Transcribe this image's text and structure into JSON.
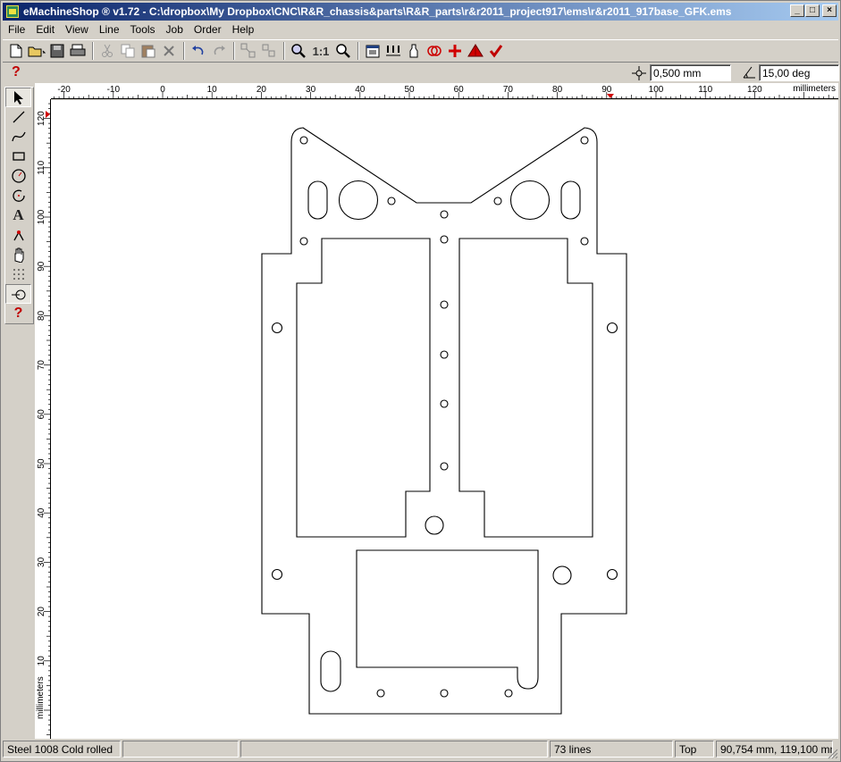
{
  "window": {
    "title": "eMachineShop ® v1.72 - C:\\dropbox\\My Dropbox\\CNC\\R&R_chassis&parts\\R&R_parts\\r&r2011_project917\\ems\\r&r2011_917base_GFK.ems",
    "controls": {
      "minimize": "_",
      "maximize": "□",
      "close": "×"
    }
  },
  "menu": [
    "File",
    "Edit",
    "View",
    "Line",
    "Tools",
    "Job",
    "Order",
    "Help"
  ],
  "toolbar": {
    "icons": [
      "new-icon",
      "open-icon",
      "save-icon",
      "print-icon",
      "cut-icon",
      "copy-icon",
      "paste-icon",
      "delete-icon",
      "undo-icon",
      "redo-icon",
      "group-icon",
      "ungroup-icon",
      "zoom-in-icon",
      "zoom-1to1-icon",
      "zoom-icon",
      "properties-icon",
      "dimension-icon",
      "bottle-icon",
      "check-overlap-icon",
      "add-point-icon",
      "3d-view-icon",
      "check-icon"
    ],
    "zoom_1to1_label": "1:1"
  },
  "snap": {
    "grid_value": "0,500 mm",
    "angle_value": "15,00 deg"
  },
  "palette": [
    "pointer-tool-icon",
    "line-tool-icon",
    "curve-tool-icon",
    "rectangle-tool-icon",
    "circle-tool-icon",
    "arc-tool-icon",
    "text-tool-icon",
    "node-tool-icon",
    "hand-tool-icon",
    "grid-tool-icon",
    "snap-tool-icon",
    "help-tool-icon"
  ],
  "ruler": {
    "unit": "millimeters",
    "h_ticks": [
      "-20",
      "-10",
      "0",
      "10",
      "20",
      "30",
      "40",
      "50",
      "60",
      "70",
      "80",
      "90",
      "100",
      "110",
      "120"
    ],
    "v_ticks": [
      "120",
      "110",
      "100",
      "90",
      "80",
      "70",
      "60",
      "50",
      "40",
      "30",
      "20",
      "10"
    ]
  },
  "status": {
    "material": "Steel 1008 Cold rolled",
    "blank1": "",
    "blank2": "",
    "lines": "73 lines",
    "view": "Top",
    "coords": "90,754 mm, 119,100 mm"
  },
  "colors": {
    "accent": "#0a246a",
    "accent_light": "#a6caf0",
    "help_red": "#c00000"
  }
}
